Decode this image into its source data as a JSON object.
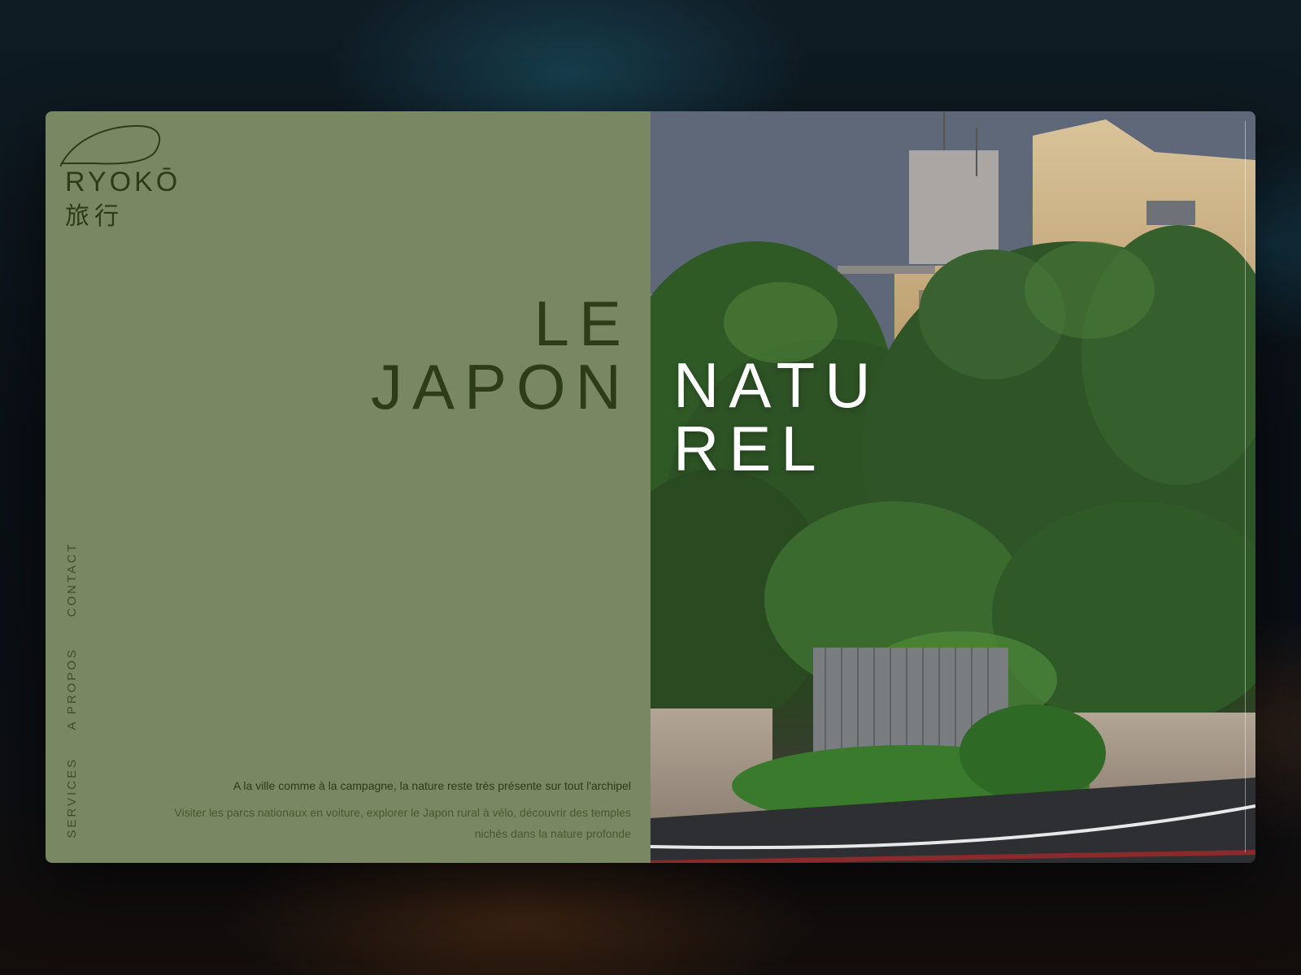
{
  "brand": {
    "name": "RYOKŌ",
    "kanji": "旅行"
  },
  "hero": {
    "left_line1": "LE",
    "left_line2": "JAPON",
    "right_line1": "NATU",
    "right_line2": "REL"
  },
  "nav": {
    "items": [
      {
        "label": "CONTACT"
      },
      {
        "label": "A PROPOS"
      },
      {
        "label": "SERVICES"
      }
    ]
  },
  "description": {
    "lead": "A la ville comme à la campagne, la nature reste très présente sur tout l'archipel",
    "body": "Visiter les parcs nationaux en voiture, explorer le Japon rural à vélo, découvrir des temples nichés dans la nature profonde"
  },
  "colors": {
    "panel_green": "#798862",
    "text_dark_green": "#2d3d18",
    "hero_white": "#ffffff"
  }
}
